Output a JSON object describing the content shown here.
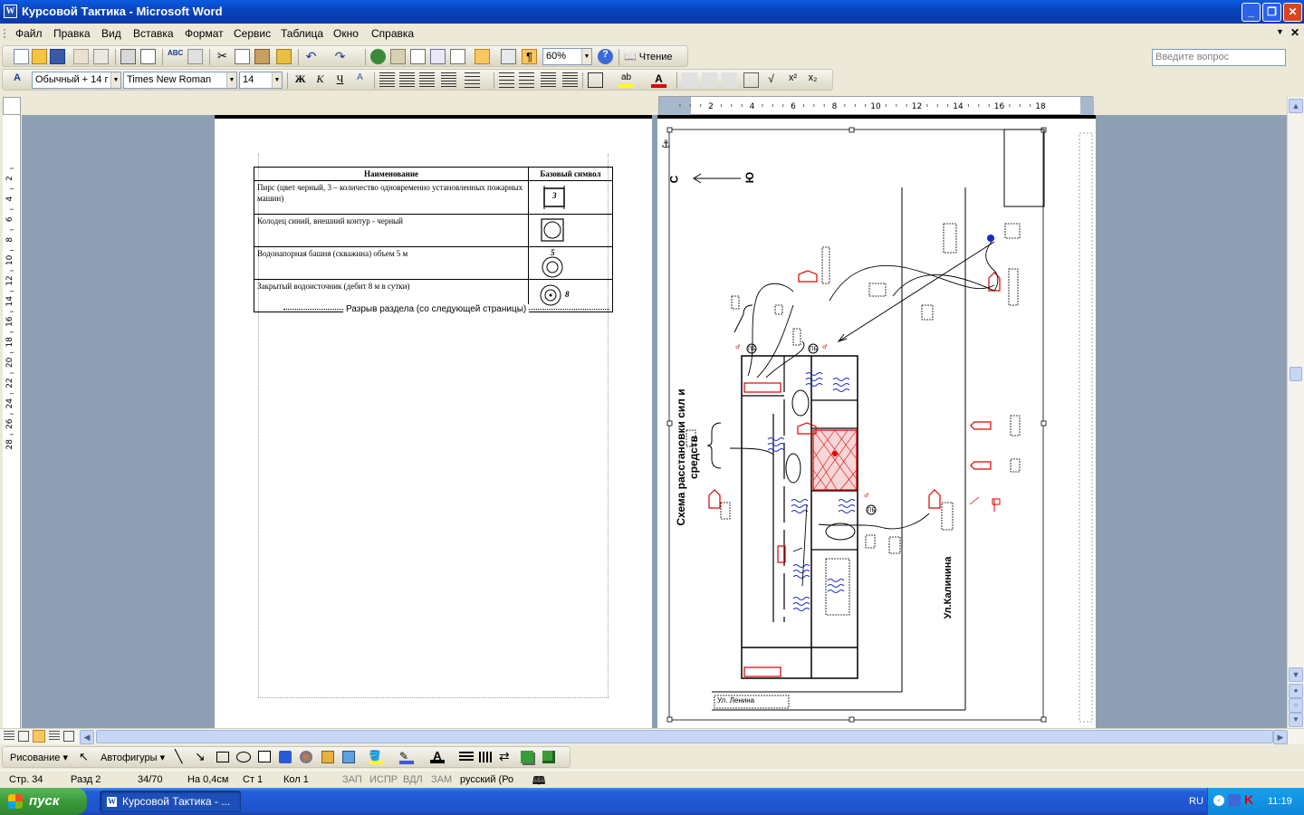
{
  "window": {
    "title": "Курсовой Тактика - Microsoft Word",
    "icon": "word-icon",
    "controls": {
      "minimize": "_",
      "restore": "❐",
      "close": "✕"
    }
  },
  "menu": {
    "items": [
      "Файл",
      "Правка",
      "Вид",
      "Вставка",
      "Формат",
      "Сервис",
      "Таблица",
      "Окно",
      "Справка"
    ],
    "help_placeholder": "Введите вопрос"
  },
  "standard_toolbar": {
    "zoom": "60%",
    "reading_button": "Чтение"
  },
  "format_toolbar": {
    "style": "Обычный + 14 г",
    "font": "Times New Roman",
    "size": "14"
  },
  "rulers": {
    "h_ticks": [
      "2",
      "4",
      "6",
      "8",
      "10",
      "12",
      "14",
      "16",
      "18"
    ],
    "v_ticks": [
      "2",
      "4",
      "6",
      "8",
      "10",
      "12",
      "14",
      "16",
      "18",
      "20",
      "22",
      "24",
      "26",
      "28"
    ]
  },
  "page_left": {
    "table_headers": [
      "Наименование",
      "Базовый символ"
    ],
    "rows": [
      {
        "name": "Пирс (цвет черный, 3 – количество одновременно установленных пожарных машин)",
        "symbol_label": "3"
      },
      {
        "name": "Колодец синий, внешний контур - черный",
        "symbol_label": ""
      },
      {
        "name": "Водонапорная башня (скважина) объем 5 м",
        "symbol_label": "5"
      },
      {
        "name": "Закрытый водоисточник (дебит 8 м в сутки)",
        "symbol_label": "8"
      }
    ],
    "section_break": "Разрыв раздела (со следующей страницы)"
  },
  "page_right": {
    "scheme_title": "Схема расстановки сил и средств",
    "street_kalinina": "Ул.Калинина",
    "street_lenina": "Ул. Ленина",
    "compass_c": "С",
    "compass_u": "Ю"
  },
  "drawbar": {
    "drawing": "Рисование",
    "autoshapes": "Автофигуры"
  },
  "status": {
    "page": "Стр. 34",
    "section": "Разд 2",
    "pages": "34/70",
    "at": "На 0,4см",
    "line": "Ст 1",
    "col": "Кол 1",
    "rec": "ЗАП",
    "trk": "ИСПР",
    "ext": "ВДЛ",
    "ovr": "ЗАМ",
    "lang": "русский (Ро"
  },
  "taskbar": {
    "start": "пуск",
    "task": "Курсовой Тактика - ...",
    "lang": "RU",
    "time": "11:19"
  },
  "colors": {
    "title_blue": "#0842b8",
    "taskbar_blue": "#245edb",
    "start_green": "#3a9a3a",
    "doc_bg": "#8e9fb4"
  }
}
